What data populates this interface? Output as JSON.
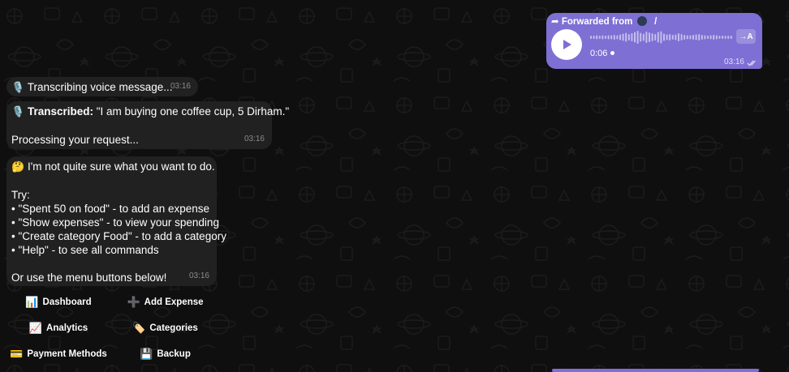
{
  "colors": {
    "background": "#0f0f0f",
    "incoming_bubble": "#212121",
    "outgoing_bubble": "#7e6fd4",
    "timestamp": "#8a8a8a"
  },
  "voice_message": {
    "forwarded_label": "Forwarded from",
    "forwarded_source": "⁣⁣ ⁣ / ⁣⁣",
    "play_icon": "play-icon",
    "duration": "0:06",
    "transcribe_label": "→A",
    "time": "03:16",
    "progress": 0.0
  },
  "messages": [
    {
      "emoji": "🎙️",
      "text": "Transcribing voice message...",
      "time": "03:16"
    },
    {
      "emoji": "🎙️",
      "bold": "Transcribed:",
      "text": " \"I am buying one coffee cup, 5 Dirham.\"",
      "line2": "Processing your request...",
      "time": "03:16"
    },
    {
      "emoji": "🤔",
      "text": " I'm not quite sure what you want to do.",
      "try_label": "Try:",
      "items": [
        "• \"Spent 50 on food\" - to add an expense",
        "• \"Show expenses\" - to view your spending",
        "• \"Create category Food\" - to add a category",
        "• \"Help\" - to see all commands"
      ],
      "footer": "Or use the menu buttons below!",
      "time": "03:16"
    }
  ],
  "keyboard": [
    {
      "icon": "📊",
      "label": "Dashboard"
    },
    {
      "icon": "➕",
      "label": "Add Expense"
    },
    {
      "icon": "📈",
      "label": "Analytics"
    },
    {
      "icon": "🏷️",
      "label": "Categories"
    },
    {
      "icon": "💳",
      "label": "Payment Methods"
    },
    {
      "icon": "💾",
      "label": "Backup"
    }
  ]
}
